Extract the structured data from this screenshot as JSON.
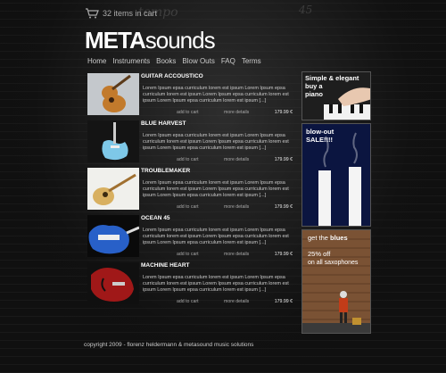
{
  "cart": {
    "text": "32 items in cart",
    "icon": "cart-icon"
  },
  "score_text": {
    "tempo": "tempo",
    "measure": "45"
  },
  "logo": {
    "bold": "META",
    "thin": "sounds"
  },
  "nav": [
    "Home",
    "Instruments",
    "Books",
    "Blow Outs",
    "FAQ",
    "Terms"
  ],
  "products": [
    {
      "name": "GUITAR ACCOUSTICO",
      "desc": "Lorem Ipsum epsa curriculum lorem est ipsum Lorem Ipsum epsa curriculum lorem est ipsum Lorem Ipsum epsa curriculum lorem est ipsum Lorem Ipsum epsa curriculum lorem est ipsum [...]",
      "add": "add to cart",
      "more": "more details",
      "price": "179.99 €"
    },
    {
      "name": "BLUE HARVEST",
      "desc": "Lorem Ipsum epsa curriculum lorem est ipsum Lorem Ipsum epsa curriculum lorem est ipsum Lorem Ipsum epsa curriculum lorem est ipsum Lorem Ipsum epsa curriculum lorem est ipsum [...]",
      "add": "add to cart",
      "more": "more details",
      "price": "179.99 €"
    },
    {
      "name": "TROUBLEMAKER",
      "desc": "Lorem Ipsum epsa curriculum lorem est ipsum Lorem Ipsum epsa curriculum lorem est ipsum Lorem Ipsum epsa curriculum lorem est ipsum Lorem Ipsum epsa curriculum lorem est ipsum [...]",
      "add": "add to cart",
      "more": "more details",
      "price": "179.99 €"
    },
    {
      "name": "OCEAN 45",
      "desc": "Lorem Ipsum epsa curriculum lorem est ipsum Lorem Ipsum epsa curriculum lorem est ipsum Lorem Ipsum epsa curriculum lorem est ipsum Lorem Ipsum epsa curriculum lorem est ipsum [...]",
      "add": "add to cart",
      "more": "more details",
      "price": "179.99 €"
    },
    {
      "name": "MACHINE HEART",
      "desc": "Lorem Ipsum epsa curriculum lorem est ipsum Lorem Ipsum epsa curriculum lorem est ipsum Lorem Ipsum epsa curriculum lorem est ipsum Lorem Ipsum epsa curriculum lorem est ipsum [...]",
      "add": "add to cart",
      "more": "more details",
      "price": "179.99 €"
    }
  ],
  "ads": {
    "piano": {
      "line1": "Simple & elegant",
      "line2": "buy a",
      "line3": "piano"
    },
    "blowout": {
      "line1": "blow-out",
      "line2": "SALE!!!!"
    },
    "blues": {
      "line1a": "get the ",
      "line1b": "blues",
      "line2": "25% off",
      "line3": "on all saxophones"
    }
  },
  "footer": "copyright 2009 - florenz heldermann & metasound music solutions"
}
